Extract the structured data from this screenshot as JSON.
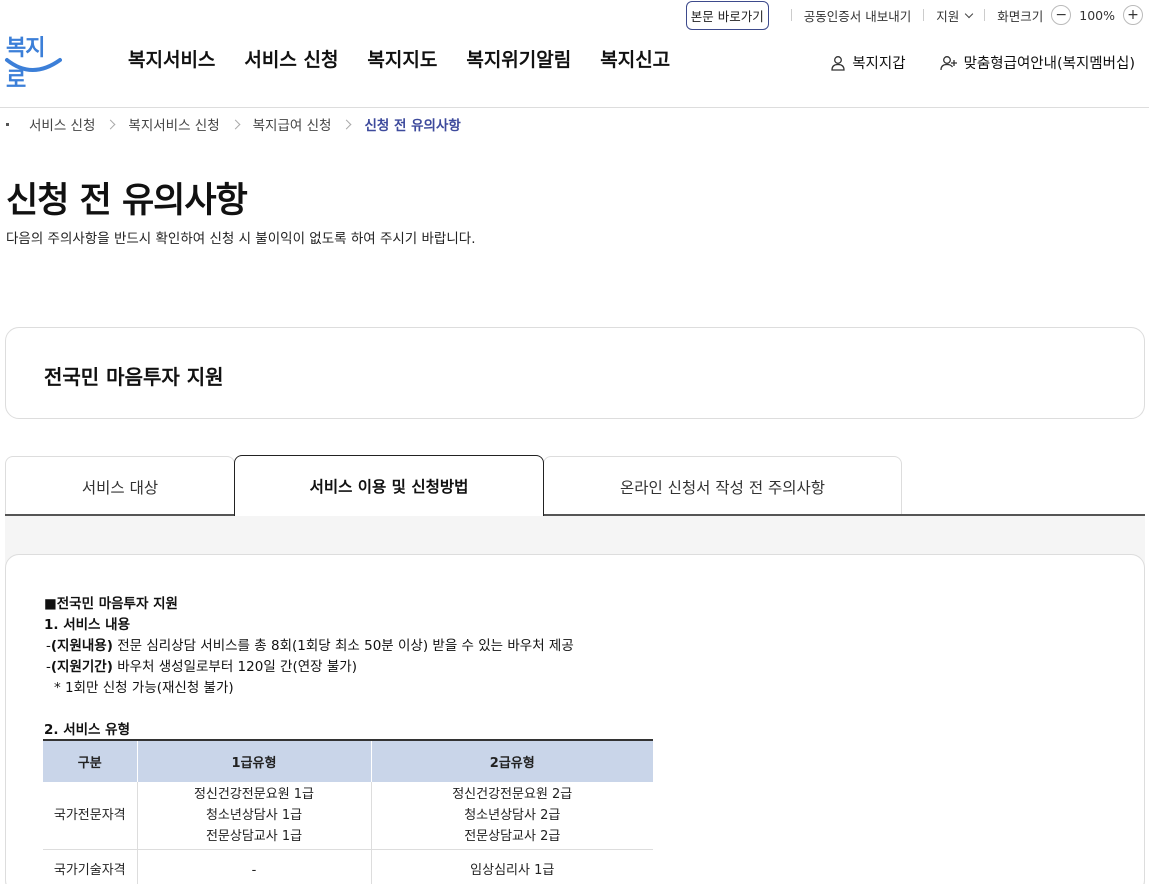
{
  "utility": {
    "skip_link": "본문 바로가기",
    "cert_export": "공동인증서 내보내기",
    "support": "지원",
    "screen_size": "화면크기",
    "zoom_minus": "−",
    "zoom_value": "100%",
    "zoom_plus": "+"
  },
  "logo": {
    "text": "복지로"
  },
  "gnb": [
    "복지서비스",
    "서비스 신청",
    "복지지도",
    "복지위기알림",
    "복지신고"
  ],
  "user_links": {
    "wallet": "복지지갑",
    "membership": "맞춤형급여안내(복지멤버십)"
  },
  "breadcrumb": [
    "서비스 신청",
    "복지서비스 신청",
    "복지급여 신청",
    "신청 전 유의사항"
  ],
  "page": {
    "title": "신청 전 유의사항",
    "description": "다음의 주의사항을 반드시 확인하여 신청 시 불이익이 없도록 하여 주시기 바랍니다."
  },
  "service_name": "전국민 마음투자 지원",
  "tabs": [
    "서비스 대상",
    "서비스 이용 및 신청방법",
    "온라인 신청서 작성 전 주의사항"
  ],
  "active_tab": 1,
  "content": {
    "heading": "■전국민 마음투자 지원",
    "section1_title": "1. 서비스 내용",
    "line1_prefix": "-",
    "line1_label": "(지원내용)",
    "line1_text": " 전문 심리상담 서비스를 총 8회(1회당 최소 50분 이상) 받을 수 있는 바우처 제공",
    "line2_prefix": "-",
    "line2_label": "(지원기간)",
    "line2_text": " 바우처 생성일로부터 120일 간(연장 불가)",
    "line3": "* 1회만 신청 가능(재신청 불가)",
    "section2_title": "2. 서비스 유형",
    "table": {
      "headers": [
        "구분",
        "1급유형",
        "2급유형"
      ],
      "rows": [
        {
          "category": "국가전문자격",
          "type1": [
            "정신건강전문요원 1급",
            "청소년상담사 1급",
            "전문상담교사 1급"
          ],
          "type2": [
            "정신건강전문요원 2급",
            "청소년상담사 2급",
            "전문상담교사 2급"
          ]
        },
        {
          "category": "국가기술자격",
          "type1": [
            "-"
          ],
          "type2": [
            "임상심리사 1급"
          ]
        }
      ]
    }
  }
}
